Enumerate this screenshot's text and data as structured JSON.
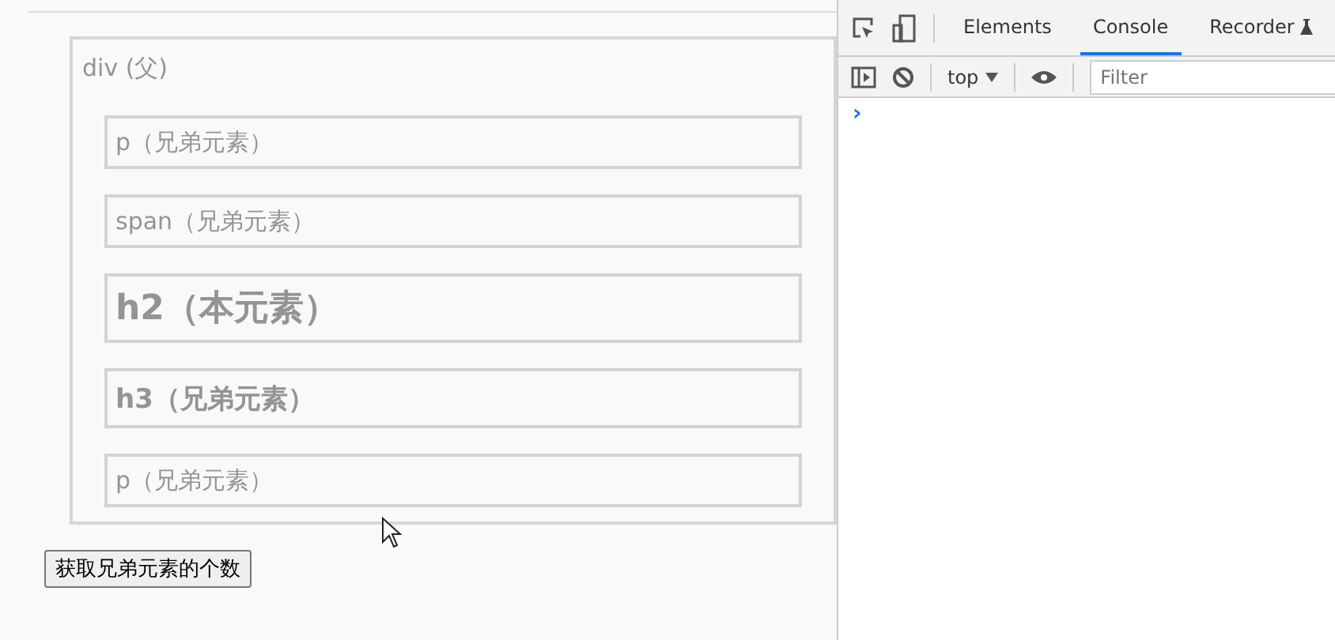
{
  "page": {
    "parent_label": "div (父)",
    "children": [
      {
        "kind": "p",
        "label": "p（兄弟元素）"
      },
      {
        "kind": "span",
        "label": "span（兄弟元素）"
      },
      {
        "kind": "h2",
        "label": "h2（本元素）"
      },
      {
        "kind": "h3",
        "label": "h3（兄弟元素）"
      },
      {
        "kind": "p",
        "label": "p（兄弟元素）"
      }
    ],
    "button": "获取兄弟元素的个数"
  },
  "devtools": {
    "tabs": [
      {
        "label": "Elements",
        "selected": false
      },
      {
        "label": "Console",
        "selected": true
      },
      {
        "label": "Recorder",
        "selected": false
      }
    ],
    "context": "top",
    "filter": {
      "placeholder": "Filter"
    },
    "prompt": "›"
  }
}
